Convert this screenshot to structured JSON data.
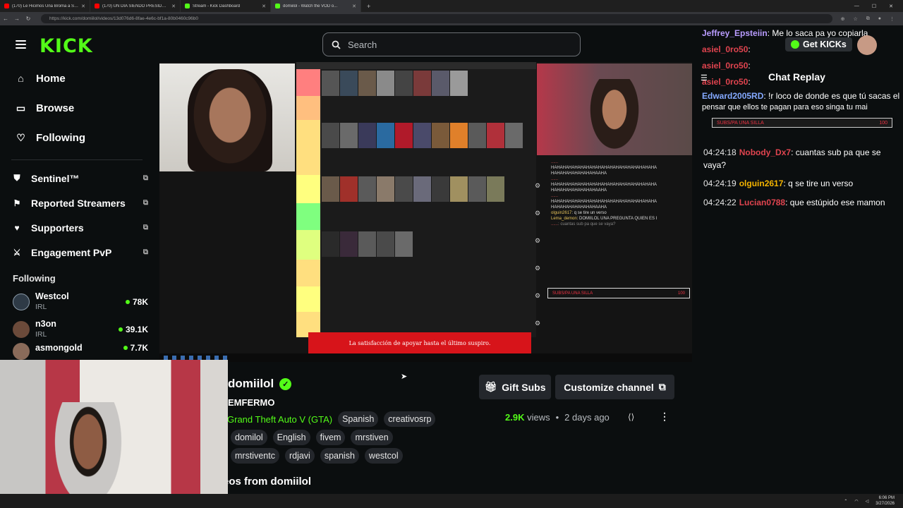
{
  "browser": {
    "tabs": [
      {
        "title": "(170) Le Hicimos Una Broma a So...",
        "color": "#ff0000",
        "active": false
      },
      {
        "title": "(170) UN DÍA SIENDO PRESIDENTE",
        "color": "#ff0000",
        "active": false
      },
      {
        "title": "Stream - Kick Dashboard",
        "color": "#53fc18",
        "active": false
      },
      {
        "title": "domiilol - Watch the VOD o...",
        "color": "#53fc18",
        "active": true
      }
    ],
    "url": "https://kick.com/domiilol/videos/13d076d6-8fae-4e6c-bf1a-80b0460c96b0"
  },
  "header": {
    "logo": "KICK",
    "search_placeholder": "Search"
  },
  "sidebar": {
    "nav": [
      {
        "label": "Home",
        "icon": "home-icon"
      },
      {
        "label": "Browse",
        "icon": "browse-icon"
      },
      {
        "label": "Following",
        "icon": "heart-icon"
      }
    ],
    "extensions": [
      {
        "label": "Sentinel™",
        "icon": "shield-icon"
      },
      {
        "label": "Reported Streamers",
        "icon": "flag-icon"
      },
      {
        "label": "Supporters",
        "icon": "heart-icon"
      },
      {
        "label": "Engagement PvP",
        "icon": "swords-icon"
      }
    ],
    "following_title": "Following",
    "following": [
      {
        "name": "Westcol",
        "category": "IRL",
        "viewers": "78K",
        "color": "#2e3a46"
      },
      {
        "name": "n3on",
        "category": "IRL",
        "viewers": "39.1K",
        "color": "#6b4a3a"
      },
      {
        "name": "asmongold",
        "category": "",
        "viewers": "7.7K",
        "color": "#8a6b5a"
      }
    ]
  },
  "video": {
    "tier_labels": [
      "",
      "",
      "",
      "",
      "",
      "",
      "",
      "",
      "",
      ""
    ],
    "overlay_chat": [
      {
        "user": "......",
        "text": "HAHAHAHAHAHAHAHAHAHAHAHAHAHAHAHAHAHA HAHAHAHAHAHAHAHAAHA"
      },
      {
        "user": "......",
        "text": "HAHAHAHAHAHAHAHAHAHAHAHAHAHAHAHAHAHA HAHAHAHAHAHAHAHAAHA"
      },
      {
        "user": "......",
        "text": "HAHAHAHAHAHAHAHAHAHAHAHAHAHAHAHAHAHA HAHAHAHAHAHAHAHAAHA"
      },
      {
        "user": "olguin2617",
        "text": ": q se tire un verso"
      },
      {
        "user": "Lema_demon",
        "text": ": DOMIILOL UNA PREGUNTA QUIEN ES I"
      },
      {
        "user": "......",
        "text": ": cuantas sub pa que se vaya?"
      }
    ],
    "subs_goal": "SUBS/PA UNA SILLA",
    "subs_goal_count": "100",
    "ad_text": "La satisfacción de apoyar hasta el último suspiro."
  },
  "channel": {
    "name": "domiilol",
    "title": "EMFERMO",
    "category": "Grand Theft Auto V (GTA)",
    "tags_row1": [
      "Spanish",
      "creativosrp"
    ],
    "tags_row2": [
      "domilol",
      "English",
      "fivem",
      "mrstiven"
    ],
    "tags_row3": [
      "mrstiventc",
      "rdjavi",
      "spanish",
      "westcol"
    ],
    "gift_label": "Gift Subs",
    "customize_label": "Customize channel",
    "views": "2.9K",
    "views_label": "views",
    "age": "2 days ago",
    "videos_from": "eos from domiilol"
  },
  "chat": {
    "stream_lines": [
      {
        "user": "Jeffrey_Epsteiin",
        "text": ": Me lo saca pa yo copiarla"
      },
      {
        "user": "asiel_0ro50",
        "text": ":"
      },
      {
        "user": "asiel_0ro50",
        "text": ":"
      },
      {
        "user": "asiel_0ro50",
        "text": ":"
      },
      {
        "user": "Edward2005RD",
        "text": ": !r loco de donde es que tú sacas el"
      },
      {
        "user": "",
        "text": "pensar que ellos te pagan para eso singa tu mai"
      }
    ],
    "get_kicks": "Get KICKs",
    "replay_title": "Chat Replay",
    "subs_goal": "SUBS/PA UNA SILLA",
    "subs_goal_count": "100",
    "messages": [
      {
        "time": "04:24:18",
        "user": "Nobody_Dx7",
        "color": "#e0444f",
        "text": ": cuantas sub pa que se vaya?"
      },
      {
        "time": "04:24:19",
        "user": "olguin2617",
        "color": "#f4b400",
        "text": ": q se tire un verso"
      },
      {
        "time": "04:24:22",
        "user": "Lucian0788",
        "color": "#e0444f",
        "text": ": que estúpido ese mamon"
      }
    ]
  },
  "os": {
    "time": "6:06 PM",
    "date": "3/27/2026"
  }
}
